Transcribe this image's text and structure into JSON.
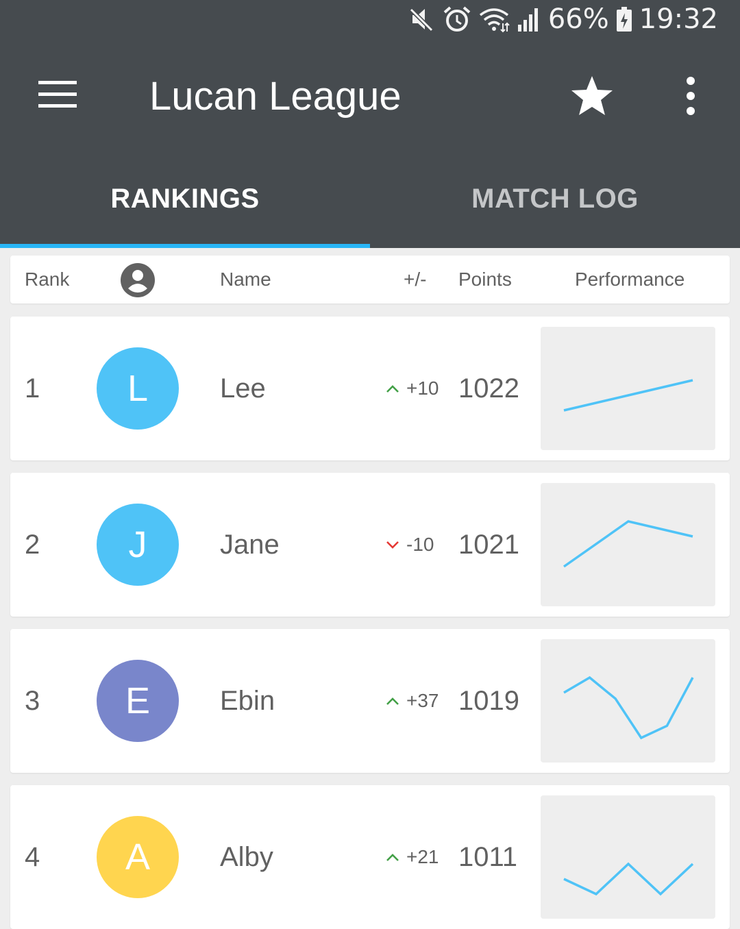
{
  "status_bar": {
    "battery": "66%",
    "time": "19:32",
    "icons": [
      "mute-icon",
      "alarm-icon",
      "wifi-icon",
      "signal-icon",
      "battery-charging-icon"
    ]
  },
  "toolbar": {
    "title": "Lucan League",
    "menu_icon": "menu-icon",
    "favorite_icon": "star-icon",
    "overflow_icon": "more-vert-icon"
  },
  "tabs": [
    {
      "label": "RANKINGS",
      "selected": true
    },
    {
      "label": "MATCH LOG",
      "selected": false
    }
  ],
  "table": {
    "headers": {
      "rank": "Rank",
      "avatar_icon": "account-circle-icon",
      "name": "Name",
      "change": "+/-",
      "points": "Points",
      "performance": "Performance"
    },
    "rows": [
      {
        "rank": "1",
        "initial": "L",
        "name": "Lee",
        "change": "+10",
        "trend": "up",
        "points": "1022",
        "avatar_color": "#4fc3f7",
        "performance": [
          1,
          2,
          3
        ]
      },
      {
        "rank": "2",
        "initial": "J",
        "name": "Jane",
        "change": "-10",
        "trend": "down",
        "points": "1021",
        "avatar_color": "#4fc3f7",
        "performance": [
          1,
          4,
          3
        ]
      },
      {
        "rank": "3",
        "initial": "E",
        "name": "Ebin",
        "change": "+37",
        "trend": "up",
        "points": "1019",
        "avatar_color": "#7986cb",
        "performance": [
          3,
          4,
          2.6,
          0,
          0.8,
          4
        ]
      },
      {
        "rank": "4",
        "initial": "A",
        "name": "Alby",
        "change": "+21",
        "trend": "up",
        "points": "1011",
        "avatar_color": "#ffd54f",
        "performance": [
          1,
          0,
          2,
          0,
          2
        ]
      }
    ]
  },
  "colors": {
    "app_bar": "#464b4f",
    "tab_indicator": "#29b6f6",
    "trend_up": "#43a047",
    "trend_down": "#e53935",
    "sparkline": "#4fc3f7"
  }
}
